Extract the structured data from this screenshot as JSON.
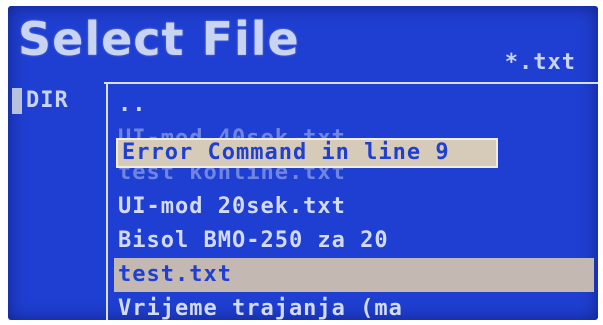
{
  "header": {
    "title": "Select File",
    "filter": "*.txt"
  },
  "dir_column": {
    "label": "DIR"
  },
  "files": [
    {
      "name": ".."
    },
    {
      "name": "UI-mod 40sek.txt"
    },
    {
      "name": "test konline.txt"
    },
    {
      "name": "UI-mod 20sek.txt"
    },
    {
      "name": "Bisol BMO-250  za 20"
    },
    {
      "name": "test.txt"
    },
    {
      "name": "Vrijeme trajanja (ma"
    }
  ],
  "error": {
    "message": "Error Command in line 9"
  },
  "colors": {
    "screen_bg": "#1f3fd2",
    "text": "#d3dbf4",
    "selection": "#c4b9b2",
    "error_bg": "#d6cab8"
  }
}
